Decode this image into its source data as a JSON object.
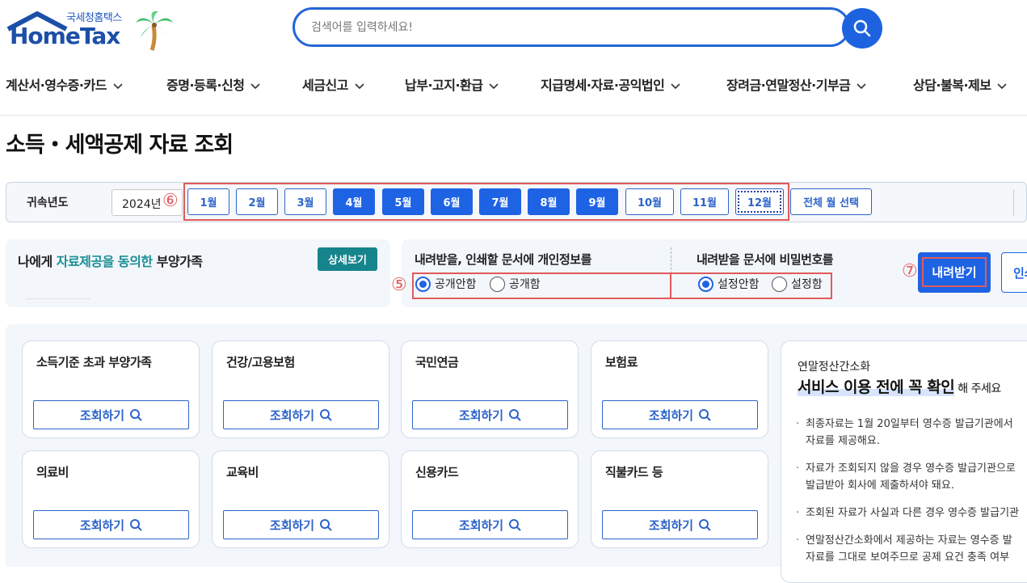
{
  "header": {
    "logo_sub": "국세청홈택스",
    "logo_word": "HomeTax",
    "search_placeholder": "검색어를 입력하세요!"
  },
  "gnb": [
    {
      "label": "계산서·영수증·카드"
    },
    {
      "label": "증명·등록·신청"
    },
    {
      "label": "세금신고"
    },
    {
      "label": "납부·고지·환급"
    },
    {
      "label": "지급명세·자료·공익법인"
    },
    {
      "label": "장려금·연말정산·기부금"
    },
    {
      "label": "상담·불복·제보"
    }
  ],
  "page_title": "소득・세액공제 자료 조회",
  "year_bar": {
    "label": "귀속년도",
    "year_value": "2024년",
    "months": [
      {
        "label": "1월",
        "selected": false
      },
      {
        "label": "2월",
        "selected": false
      },
      {
        "label": "3월",
        "selected": false
      },
      {
        "label": "4월",
        "selected": true
      },
      {
        "label": "5월",
        "selected": true
      },
      {
        "label": "6월",
        "selected": true
      },
      {
        "label": "7월",
        "selected": true
      },
      {
        "label": "8월",
        "selected": true
      },
      {
        "label": "9월",
        "selected": true
      },
      {
        "label": "10월",
        "selected": false
      },
      {
        "label": "11월",
        "selected": false
      },
      {
        "label": "12월",
        "selected": false
      }
    ],
    "all_months": "전체 월 선택"
  },
  "annotations": {
    "m5": "⑤",
    "m6": "⑥",
    "m7": "⑦"
  },
  "dependents": {
    "prefix": "나에게 ",
    "highlight": "자료제공을 동의한",
    "suffix": " 부양가족",
    "detail_button": "상세보기"
  },
  "options": {
    "personal_info_title": "내려받을, 인쇄할 문서에 개인정보를",
    "personal_info": [
      {
        "label": "공개안함",
        "checked": true
      },
      {
        "label": "공개함",
        "checked": false
      }
    ],
    "password_title": "내려받을 문서에 비밀번호를",
    "password": [
      {
        "label": "설정안함",
        "checked": true
      },
      {
        "label": "설정함",
        "checked": false
      }
    ],
    "download_button": "내려받기",
    "print_button": "인쇄"
  },
  "cards": [
    {
      "title": "소득기준 초과 부양가족",
      "button": "조회하기"
    },
    {
      "title": "건강/고용보험",
      "button": "조회하기"
    },
    {
      "title": "국민연금",
      "button": "조회하기"
    },
    {
      "title": "보험료",
      "button": "조회하기"
    },
    {
      "title": "의료비",
      "button": "조회하기"
    },
    {
      "title": "교육비",
      "button": "조회하기"
    },
    {
      "title": "신용카드",
      "button": "조회하기"
    },
    {
      "title": "직불카드 등",
      "button": "조회하기"
    }
  ],
  "notice": {
    "subtitle": "연말정산간소화",
    "title_hl": "서비스 이용 전에 꼭 확인",
    "title_rest": "해 주세요",
    "bullets": [
      {
        "l1": "최종자료는 1월 20일부터 영수증 발급기관에서",
        "l2": "자료를 제공해요."
      },
      {
        "l1": "자료가 조회되지 않을 경우 영수증 발급기관으로",
        "l2": "발급받아 회사에 제출하셔야 돼요."
      },
      {
        "l1": "조회된 자료가 사실과 다른 경우 영수증 발급기관",
        "l2": ""
      },
      {
        "l1": "연말정산간소화에서 제공하는 자료는 영수증 발",
        "l2": "자료를 그대로 보여주므로 공제 요건 충족 여부"
      }
    ]
  },
  "colors": {
    "primary": "#1f63e5",
    "teal": "#16848b",
    "annotation_red": "#e15b5b"
  }
}
